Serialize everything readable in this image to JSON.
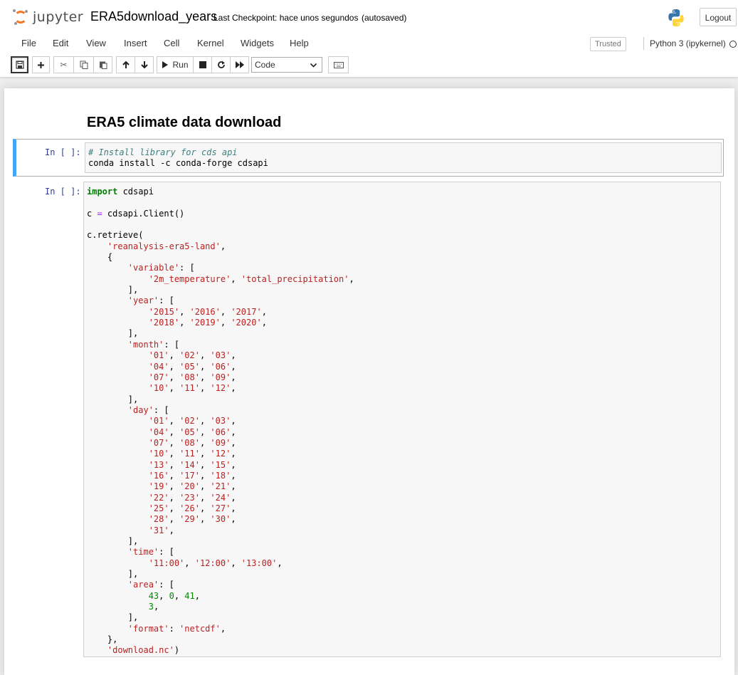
{
  "header": {
    "logo_text": "jupyter",
    "notebook_name": "ERA5download_years",
    "checkpoint": "Last Checkpoint: hace unos segundos",
    "autosave": "(autosaved)",
    "logout_label": "Logout"
  },
  "menu": {
    "items": [
      "File",
      "Edit",
      "View",
      "Insert",
      "Cell",
      "Kernel",
      "Widgets",
      "Help"
    ],
    "trusted": "Trusted",
    "kernel": "Python 3 (ipykernel)"
  },
  "toolbar": {
    "run_label": "Run",
    "cell_type": "Code",
    "icons": [
      "save-icon",
      "plus-icon",
      "cut-icon",
      "copy-icon",
      "paste-icon",
      "arrow-up-icon",
      "arrow-down-icon",
      "play-icon",
      "stop-icon",
      "restart-icon",
      "fast-forward-icon",
      "keyboard-icon"
    ]
  },
  "notebook": {
    "heading": "ERA5 climate data download",
    "cells": [
      {
        "prompt": "In [ ]:",
        "lines": [
          "# Install library for cds api",
          "conda install -c conda-forge cdsapi"
        ]
      },
      {
        "prompt": "In [ ]:",
        "lines": [
          "import cdsapi",
          "",
          "c = cdsapi.Client()",
          "",
          "c.retrieve(",
          "    'reanalysis-era5-land',",
          "    {",
          "        'variable': [",
          "            '2m_temperature', 'total_precipitation',",
          "        ],",
          "        'year': [",
          "            '2015', '2016', '2017',",
          "            '2018', '2019', '2020',",
          "        ],",
          "        'month': [",
          "            '01', '02', '03',",
          "            '04', '05', '06',",
          "            '07', '08', '09',",
          "            '10', '11', '12',",
          "        ],",
          "        'day': [",
          "            '01', '02', '03',",
          "            '04', '05', '06',",
          "            '07', '08', '09',",
          "            '10', '11', '12',",
          "            '13', '14', '15',",
          "            '16', '17', '18',",
          "            '19', '20', '21',",
          "            '22', '23', '24',",
          "            '25', '26', '27',",
          "            '28', '29', '30',",
          "            '31',",
          "        ],",
          "        'time': [",
          "            '11:00', '12:00', '13:00',",
          "        ],",
          "        'area': [",
          "            43, 0, 41,",
          "            3,",
          "        ],",
          "        'format': 'netcdf',",
          "    },",
          "    'download.nc')"
        ]
      }
    ]
  },
  "colors": {
    "accent_selected": "#42a5f5",
    "logo_orange": "#f37726",
    "prompt_in": "#303f9f"
  }
}
